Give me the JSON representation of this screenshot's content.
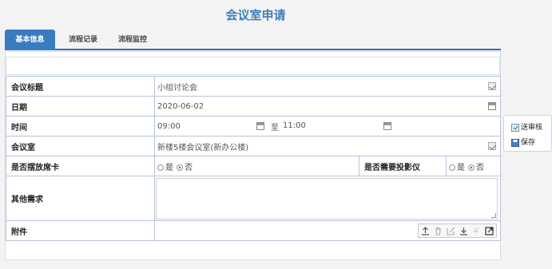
{
  "page_title": "会议室申请",
  "tabs": [
    {
      "label": "基本信息",
      "active": true
    },
    {
      "label": "流程记录",
      "active": false
    },
    {
      "label": "流程监控",
      "active": false
    }
  ],
  "form": {
    "topic": {
      "label": "会议标题",
      "value": "小组讨论会"
    },
    "date": {
      "label": "日期",
      "value": "2020-06-02"
    },
    "time": {
      "label": "时间",
      "start": "09:00",
      "separator": "至",
      "end": "11:00"
    },
    "room": {
      "label": "会议室",
      "value": "新楼5楼会议室(新办公楼)"
    },
    "name_card": {
      "label": "是否摆放席卡",
      "yes": "是",
      "no": "否",
      "selected": "否"
    },
    "projector": {
      "label": "是否需要投影仪",
      "yes": "是",
      "no": "否",
      "selected": "否"
    },
    "other": {
      "label": "其他需求",
      "value": ""
    },
    "attachment": {
      "label": "附件"
    }
  },
  "attachment_toolbar": {
    "icons": [
      "upload-icon",
      "delete-icon",
      "edit-icon",
      "download-icon",
      "batch-download-icon",
      "open-external-icon"
    ]
  },
  "side_actions": {
    "submit": "送审核",
    "save": "保存"
  },
  "colors": {
    "accent": "#3a7bc0",
    "title": "#3f7ec0",
    "border": "#b8c4da"
  }
}
